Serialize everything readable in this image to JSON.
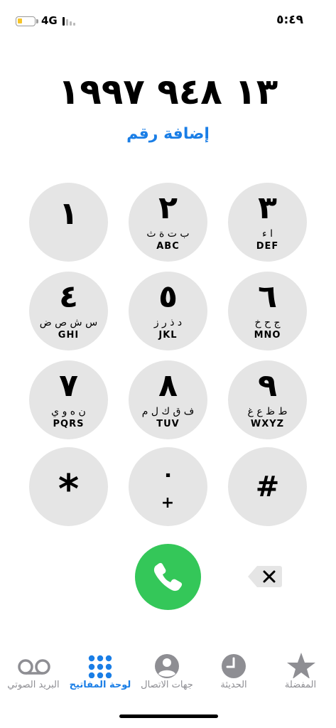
{
  "status": {
    "network": "4G",
    "time": "٥:٤٩"
  },
  "dial": {
    "number": "١٣ ٩٤٨ ١٩٩٧",
    "add_number": "إضافة رقم"
  },
  "keys": [
    {
      "digit": "١",
      "arabic": "",
      "latin": ""
    },
    {
      "digit": "٢",
      "arabic": "ب ت ة ث",
      "latin": "ABC"
    },
    {
      "digit": "٣",
      "arabic": "ا ء",
      "latin": "DEF"
    },
    {
      "digit": "٤",
      "arabic": "س ش ص ض",
      "latin": "GHI"
    },
    {
      "digit": "٥",
      "arabic": "د ذ ر ز",
      "latin": "JKL"
    },
    {
      "digit": "٦",
      "arabic": "ج ح خ",
      "latin": "MNO"
    },
    {
      "digit": "٧",
      "arabic": "ن ه و ي",
      "latin": "PQRS"
    },
    {
      "digit": "٨",
      "arabic": "ف ق ك ل م",
      "latin": "TUV"
    },
    {
      "digit": "٩",
      "arabic": "ط ظ ع غ",
      "latin": "WXYZ"
    },
    {
      "digit": "*",
      "arabic": "",
      "latin": ""
    },
    {
      "digit": "٠",
      "arabic": "",
      "latin": "+"
    },
    {
      "digit": "#",
      "arabic": "",
      "latin": ""
    }
  ],
  "tabs": [
    {
      "label": "البريد الصوتي",
      "icon": "voicemail-icon"
    },
    {
      "label": "لوحة المفاتيح",
      "icon": "keypad-icon",
      "active": true
    },
    {
      "label": "جهات الاتصال",
      "icon": "contacts-icon"
    },
    {
      "label": "الحديثة",
      "icon": "clock-icon"
    },
    {
      "label": "المفضلة",
      "icon": "star-icon"
    }
  ],
  "colors": {
    "accent": "#1a7ee6",
    "call": "#34c759",
    "key": "#e5e5e5",
    "inactive": "#8e8e93",
    "battery": "#f6c428"
  }
}
